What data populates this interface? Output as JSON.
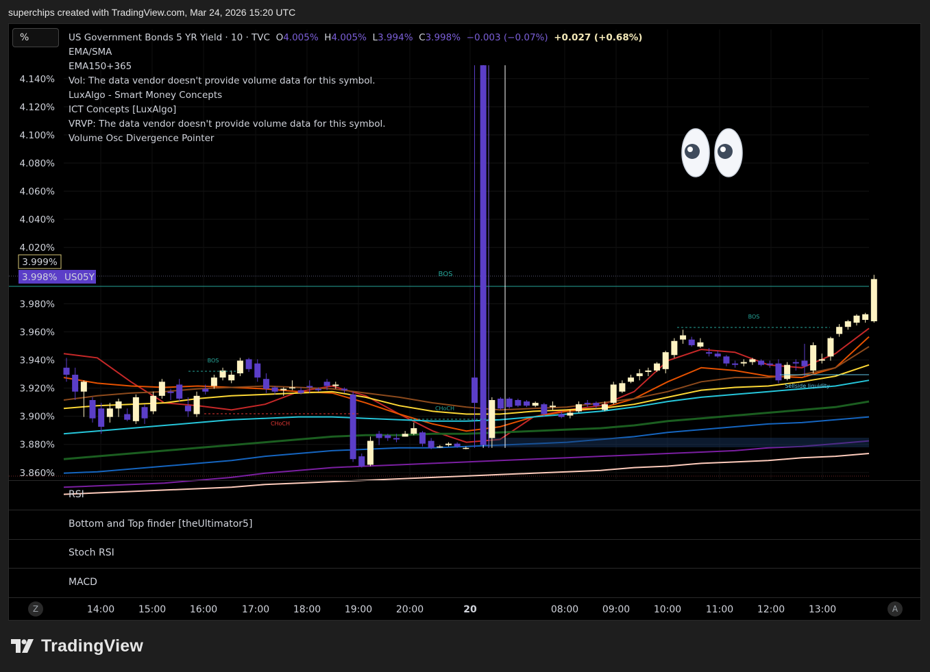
{
  "caption": "superchips created with TradingView.com, Mar 24, 2026 15:20 UTC",
  "toolbar": {
    "scale_button": "%"
  },
  "legend": {
    "symbol": "US Government Bonds 5 YR Yield · 10 · TVC",
    "open_label": "O",
    "open": "4.005%",
    "high_label": "H",
    "high": "4.005%",
    "low_label": "L",
    "low": "3.994%",
    "close_label": "C",
    "close": "3.998%",
    "change": "−0.003 (−0.07%)",
    "day_change": "+0.027 (+0.68%)",
    "indicators": [
      "EMA/SMA",
      "EMA150+365",
      "Vol: The data vendor doesn't provide volume data for this symbol.",
      "LuxAlgo - Smart Money Concepts",
      "ICT Concepts [LuxAlgo]",
      "VRVP: The data vendor doesn't provide volume data for this symbol.",
      "Volume Osc Divergence Pointer"
    ]
  },
  "price_axis": {
    "ticks": [
      "4.140%",
      "4.120%",
      "4.100%",
      "4.080%",
      "4.060%",
      "4.040%",
      "4.020%",
      "3.980%",
      "3.960%",
      "3.940%",
      "3.920%",
      "3.900%",
      "3.880%",
      "3.860%"
    ],
    "crosshair_label": "3.999%",
    "last_price_label": "3.998%",
    "symbol_tag": "US05Y"
  },
  "time_axis": {
    "ticks": [
      "14:00",
      "15:00",
      "16:00",
      "17:00",
      "18:00",
      "19:00",
      "20:00",
      "20",
      "08:00",
      "09:00",
      "10:00",
      "11:00",
      "12:00",
      "13:00"
    ],
    "left_button": "Z",
    "right_button": "A"
  },
  "annotations": {
    "bos_main": "BOS",
    "bos_left": "BOS",
    "bos_right": "BOS",
    "choch_red": "CHoCH",
    "choch_green": "CHoCH",
    "sellside": "Sellside liquidity"
  },
  "panes": [
    "RSI",
    "Bottom and Top finder [theUltimator5]",
    "Stoch RSI",
    "MACD"
  ],
  "emoji": "👀",
  "brand": "TradingView",
  "colors": {
    "bull_candle": "#fff3c2",
    "bear_candle": "#5b3ec8",
    "bos_line": "#26a69a",
    "background": "#000000"
  },
  "chart_data": {
    "type": "candlestick",
    "title": "US Government Bonds 5 YR Yield · 10 · TVC",
    "ylabel": "",
    "ylim": [
      3.856,
      4.152
    ],
    "ohlc": [
      [
        3.935,
        3.942,
        3.925,
        3.93
      ],
      [
        3.93,
        3.935,
        3.912,
        3.918
      ],
      [
        3.918,
        3.926,
        3.9,
        3.925
      ],
      [
        3.912,
        3.914,
        3.896,
        3.899
      ],
      [
        3.906,
        3.91,
        3.888,
        3.893
      ],
      [
        3.9,
        3.91,
        3.896,
        3.906
      ],
      [
        3.906,
        3.913,
        3.9,
        3.911
      ],
      [
        3.902,
        3.906,
        3.897,
        3.898
      ],
      [
        3.897,
        3.916,
        3.895,
        3.914
      ],
      [
        3.907,
        3.909,
        3.895,
        3.899
      ],
      [
        3.904,
        3.918,
        3.902,
        3.915
      ],
      [
        3.915,
        3.927,
        3.913,
        3.925
      ],
      [
        3.918,
        3.92,
        3.912,
        3.917
      ],
      [
        3.923,
        3.927,
        3.911,
        3.913
      ],
      [
        3.908,
        3.914,
        3.9,
        3.904
      ],
      [
        3.902,
        3.918,
        3.9,
        3.915
      ],
      [
        3.92,
        3.923,
        3.916,
        3.918
      ],
      [
        3.922,
        3.93,
        3.92,
        3.928
      ],
      [
        3.928,
        3.935,
        3.926,
        3.933
      ],
      [
        3.926,
        3.933,
        3.924,
        3.93
      ],
      [
        3.931,
        3.942,
        3.929,
        3.94
      ],
      [
        3.941,
        3.942,
        3.932,
        3.934
      ],
      [
        3.938,
        3.941,
        3.925,
        3.928
      ],
      [
        3.927,
        3.931,
        3.917,
        3.92
      ],
      [
        3.921,
        3.922,
        3.916,
        3.918
      ],
      [
        3.919,
        3.921,
        3.915,
        3.92
      ],
      [
        3.921,
        3.926,
        3.919,
        3.921
      ],
      [
        3.919,
        3.921,
        3.916,
        3.917
      ],
      [
        3.922,
        3.926,
        3.917,
        3.921
      ],
      [
        3.92,
        3.921,
        3.918,
        3.919
      ],
      [
        3.925,
        3.927,
        3.919,
        3.922
      ],
      [
        3.922,
        3.925,
        3.92,
        3.923
      ],
      [
        3.92,
        3.921,
        3.917,
        3.919
      ],
      [
        3.916,
        3.918,
        3.868,
        3.87
      ],
      [
        3.872,
        3.874,
        3.864,
        3.865
      ],
      [
        3.866,
        3.886,
        3.865,
        3.883
      ],
      [
        3.888,
        3.89,
        3.88,
        3.885
      ],
      [
        3.887,
        3.888,
        3.883,
        3.885
      ],
      [
        3.885,
        3.888,
        3.882,
        3.884
      ],
      [
        3.886,
        3.89,
        3.886,
        3.888
      ],
      [
        3.888,
        3.896,
        3.887,
        3.892
      ],
      [
        3.889,
        3.89,
        3.879,
        3.881
      ],
      [
        3.883,
        3.885,
        3.877,
        3.878
      ],
      [
        3.879,
        3.88,
        3.878,
        3.879
      ],
      [
        3.88,
        3.882,
        3.879,
        3.881
      ],
      [
        3.881,
        3.882,
        3.878,
        3.879
      ],
      [
        3.878,
        3.879,
        3.877,
        3.878
      ],
      [
        3.928,
        4.15,
        3.878,
        3.91
      ],
      [
        4.15,
        4.15,
        3.878,
        3.88
      ],
      [
        3.885,
        3.914,
        3.878,
        3.912
      ],
      [
        3.913,
        3.914,
        3.905,
        3.906
      ],
      [
        3.913,
        3.914,
        3.906,
        3.907
      ],
      [
        3.912,
        3.913,
        3.907,
        3.908
      ],
      [
        3.911,
        3.912,
        3.907,
        3.908
      ],
      [
        3.908,
        3.911,
        3.907,
        3.91
      ],
      [
        3.909,
        3.91,
        3.9,
        3.902
      ],
      [
        3.907,
        3.911,
        3.905,
        3.908
      ],
      [
        3.902,
        3.904,
        3.899,
        3.9
      ],
      [
        3.901,
        3.905,
        3.899,
        3.903
      ],
      [
        3.904,
        3.911,
        3.903,
        3.909
      ],
      [
        3.91,
        3.912,
        3.907,
        3.909
      ],
      [
        3.91,
        3.911,
        3.906,
        3.908
      ],
      [
        3.905,
        3.911,
        3.904,
        3.909
      ],
      [
        3.91,
        3.925,
        3.909,
        3.923
      ],
      [
        3.918,
        3.926,
        3.917,
        3.924
      ],
      [
        3.925,
        3.93,
        3.924,
        3.928
      ],
      [
        3.929,
        3.934,
        3.926,
        3.931
      ],
      [
        3.932,
        3.935,
        3.929,
        3.933
      ],
      [
        3.933,
        3.939,
        3.932,
        3.938
      ],
      [
        3.934,
        3.947,
        3.931,
        3.946
      ],
      [
        3.944,
        3.956,
        3.942,
        3.954
      ],
      [
        3.955,
        3.962,
        3.952,
        3.958
      ],
      [
        3.955,
        3.957,
        3.95,
        3.951
      ],
      [
        3.95,
        3.956,
        3.949,
        3.953
      ],
      [
        3.946,
        3.949,
        3.943,
        3.945
      ],
      [
        3.945,
        3.947,
        3.942,
        3.943
      ],
      [
        3.943,
        3.944,
        3.936,
        3.938
      ],
      [
        3.938,
        3.94,
        3.935,
        3.937
      ],
      [
        3.938,
        3.941,
        3.936,
        3.939
      ],
      [
        3.939,
        3.942,
        3.937,
        3.941
      ],
      [
        3.94,
        3.941,
        3.936,
        3.937
      ],
      [
        3.938,
        3.94,
        3.935,
        3.937
      ],
      [
        3.938,
        3.941,
        3.924,
        3.926
      ],
      [
        3.927,
        3.939,
        3.926,
        3.937
      ],
      [
        3.939,
        3.941,
        3.933,
        3.938
      ],
      [
        3.94,
        3.952,
        3.929,
        3.936
      ],
      [
        3.933,
        3.953,
        3.931,
        3.951
      ],
      [
        3.94,
        3.945,
        3.938,
        3.941
      ],
      [
        3.943,
        3.957,
        3.94,
        3.956
      ],
      [
        3.959,
        3.966,
        3.957,
        3.964
      ],
      [
        3.964,
        3.969,
        3.962,
        3.968
      ],
      [
        3.967,
        3.973,
        3.965,
        3.972
      ],
      [
        3.969,
        3.974,
        3.967,
        3.973
      ],
      [
        3.968,
        4.001,
        3.967,
        3.998
      ]
    ],
    "moving_averages": [
      {
        "color": "#c62828",
        "y": [
          3.945,
          3.942,
          3.925,
          3.91,
          3.908,
          3.905,
          3.909,
          3.918,
          3.922,
          3.915,
          3.902,
          3.89,
          3.882,
          3.884,
          3.9,
          3.905,
          3.908,
          3.918,
          3.94,
          3.948,
          3.946,
          3.937,
          3.935,
          3.945,
          3.963
        ]
      },
      {
        "color": "#e65100",
        "y": [
          3.928,
          3.924,
          3.922,
          3.921,
          3.922,
          3.921,
          3.92,
          3.918,
          3.917,
          3.91,
          3.902,
          3.895,
          3.89,
          3.893,
          3.9,
          3.904,
          3.906,
          3.913,
          3.925,
          3.935,
          3.933,
          3.929,
          3.928,
          3.935,
          3.957
        ]
      },
      {
        "color": "#8d4a1c",
        "y": [
          3.912,
          3.915,
          3.917,
          3.918,
          3.92,
          3.921,
          3.922,
          3.921,
          3.92,
          3.917,
          3.914,
          3.91,
          3.907,
          3.905,
          3.906,
          3.907,
          3.91,
          3.913,
          3.918,
          3.925,
          3.928,
          3.928,
          3.93,
          3.935,
          3.95
        ]
      },
      {
        "color": "#fdd835",
        "y": [
          3.906,
          3.908,
          3.909,
          3.91,
          3.913,
          3.915,
          3.916,
          3.917,
          3.918,
          3.914,
          3.908,
          3.904,
          3.902,
          3.902,
          3.904,
          3.905,
          3.906,
          3.909,
          3.914,
          3.919,
          3.921,
          3.922,
          3.925,
          3.929,
          3.937
        ]
      },
      {
        "color": "#26c6da",
        "y": [
          3.888,
          3.89,
          3.892,
          3.894,
          3.896,
          3.898,
          3.899,
          3.9,
          3.9,
          3.899,
          3.898,
          3.897,
          3.897,
          3.898,
          3.9,
          3.902,
          3.904,
          3.907,
          3.911,
          3.914,
          3.916,
          3.918,
          3.92,
          3.922,
          3.926
        ]
      },
      {
        "color": "#1b5e20",
        "y": [
          3.87,
          3.872,
          3.874,
          3.876,
          3.878,
          3.88,
          3.882,
          3.884,
          3.886,
          3.887,
          3.887,
          3.888,
          3.888,
          3.889,
          3.89,
          3.891,
          3.892,
          3.894,
          3.897,
          3.899,
          3.901,
          3.903,
          3.905,
          3.907,
          3.911
        ]
      },
      {
        "color": "#1565c0",
        "y": [
          3.86,
          3.861,
          3.863,
          3.865,
          3.867,
          3.869,
          3.872,
          3.874,
          3.876,
          3.877,
          3.878,
          3.878,
          3.879,
          3.88,
          3.881,
          3.882,
          3.884,
          3.886,
          3.889,
          3.891,
          3.893,
          3.895,
          3.896,
          3.898,
          3.9
        ]
      },
      {
        "color": "#7b1fa2",
        "y": [
          3.85,
          3.851,
          3.852,
          3.853,
          3.855,
          3.857,
          3.86,
          3.862,
          3.864,
          3.865,
          3.866,
          3.867,
          3.868,
          3.869,
          3.87,
          3.871,
          3.872,
          3.873,
          3.874,
          3.875,
          3.876,
          3.878,
          3.879,
          3.881,
          3.883
        ]
      },
      {
        "color": "#ffccbc",
        "y": [
          3.845,
          3.846,
          3.847,
          3.848,
          3.849,
          3.85,
          3.852,
          3.853,
          3.854,
          3.855,
          3.856,
          3.857,
          3.858,
          3.859,
          3.86,
          3.861,
          3.862,
          3.864,
          3.865,
          3.867,
          3.868,
          3.869,
          3.871,
          3.872,
          3.874
        ]
      }
    ]
  }
}
